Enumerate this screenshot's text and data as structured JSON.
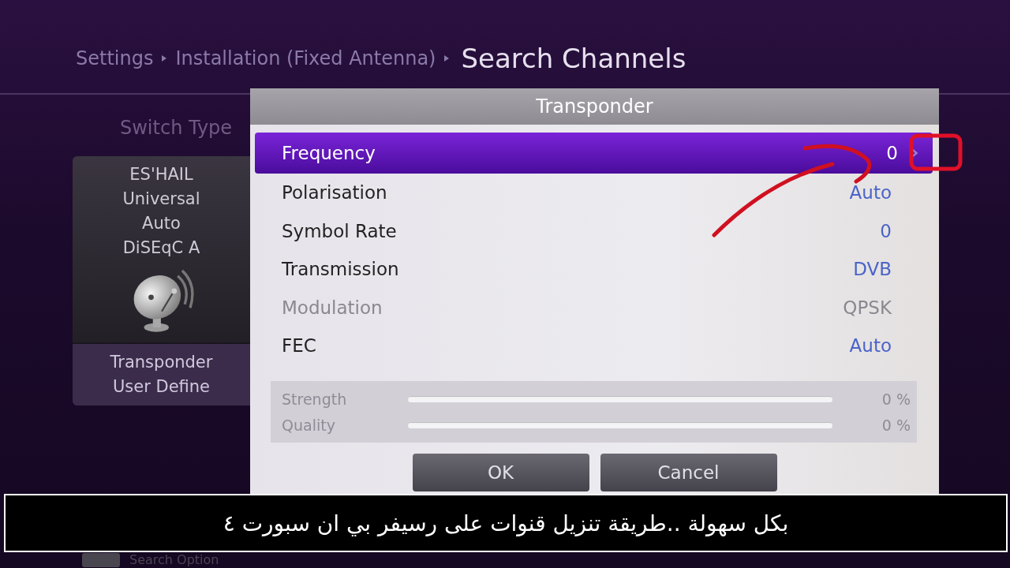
{
  "breadcrumb": [
    "Settings",
    "Installation (Fixed Antenna)"
  ],
  "title": "Search Channels",
  "switch_type_label": "Switch Type",
  "satellite_card": {
    "lines": [
      "ES'HAIL",
      "Universal",
      "Auto",
      "DiSEqC A"
    ],
    "footer": [
      "Transponder",
      "User Define"
    ]
  },
  "dialog": {
    "title": "Transponder",
    "rows": [
      {
        "label": "Frequency",
        "value": "0",
        "selected": true,
        "disabled": false
      },
      {
        "label": "Polarisation",
        "value": "Auto",
        "selected": false,
        "disabled": false
      },
      {
        "label": "Symbol Rate",
        "value": "0",
        "selected": false,
        "disabled": false
      },
      {
        "label": "Transmission",
        "value": "DVB",
        "selected": false,
        "disabled": false
      },
      {
        "label": "Modulation",
        "value": "QPSK",
        "selected": false,
        "disabled": true
      },
      {
        "label": "FEC",
        "value": "Auto",
        "selected": false,
        "disabled": false
      }
    ],
    "meters": [
      {
        "label": "Strength",
        "level": 0,
        "reading": "0 %"
      },
      {
        "label": "Quality",
        "level": 0,
        "reading": "0 %"
      }
    ],
    "buttons": [
      "OK",
      "Cancel"
    ]
  },
  "caption": "بكل سهولة ..طريقة تنزيل قنوات على رسيفر بي ان سبورت ٤",
  "hint": "Search Option"
}
